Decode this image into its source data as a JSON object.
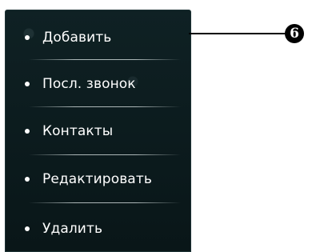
{
  "menu": {
    "items": [
      {
        "label": "Добавить"
      },
      {
        "label": "Посл. звонок"
      },
      {
        "label": "Контакты"
      },
      {
        "label": "Редактировать"
      },
      {
        "label": "Удалить"
      }
    ]
  },
  "callout": {
    "number": "6"
  },
  "colors": {
    "menu_background": "#0b1a1c",
    "text": "#ffffff",
    "callout": "#000000"
  }
}
